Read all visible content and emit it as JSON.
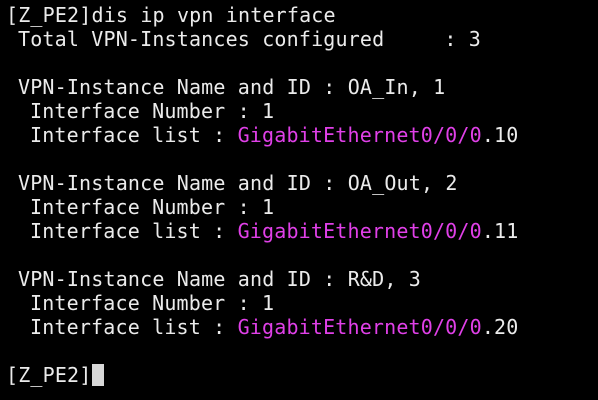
{
  "terminal": {
    "prompt": "[Z_PE2]",
    "command": "dis ip vpn interface",
    "total_label": "Total VPN-Instances configured",
    "total_sep": ": ",
    "total_value": "3",
    "instances": [
      {
        "name_label": "VPN-Instance Name and ID : ",
        "name_value": "OA_In, 1",
        "number_label": "Interface Number : ",
        "number_value": "1",
        "list_label": "Interface list : ",
        "iface_name": "GigabitEthernet0/0/0",
        "iface_sub": ".10"
      },
      {
        "name_label": "VPN-Instance Name and ID : ",
        "name_value": "OA_Out, 2",
        "number_label": "Interface Number : ",
        "number_value": "1",
        "list_label": "Interface list : ",
        "iface_name": "GigabitEthernet0/0/0",
        "iface_sub": ".11"
      },
      {
        "name_label": "VPN-Instance Name and ID : ",
        "name_value": "R&D, 3",
        "number_label": "Interface Number : ",
        "number_value": "1",
        "list_label": "Interface list : ",
        "iface_name": "GigabitEthernet0/0/0",
        "iface_sub": ".20"
      }
    ],
    "final_prompt": "[Z_PE2]",
    "colors": {
      "background": "#000000",
      "text": "#ebebeb",
      "interface_highlight": "#e040e8",
      "cursor": "#d8d8d8"
    }
  }
}
